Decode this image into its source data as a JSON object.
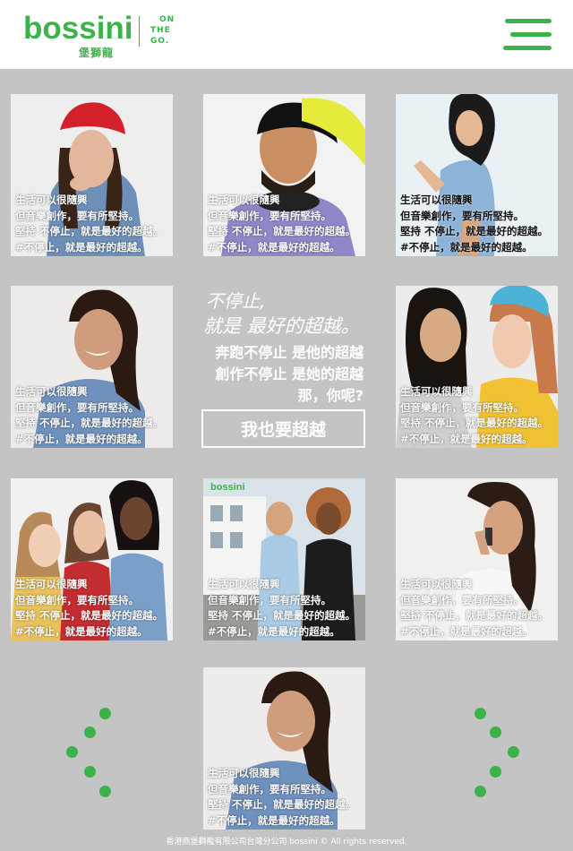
{
  "header": {
    "logo_text": "bossini",
    "logo_sub": "堡獅龍",
    "tagline": [
      "ON",
      "THE",
      "GO."
    ],
    "menu_icon": "hamburger-menu-icon"
  },
  "captions": {
    "line1": "生活可以很隨興",
    "line2": "但音樂創作，要有所堅持。",
    "line3": "堅持 不停止，就是最好的超越。",
    "line4": "#不停止，就是最好的超越。"
  },
  "center": {
    "heading1": "不停止,",
    "heading2": "就是 最好的超越。",
    "line1": "奔跑不停止 是他的超越",
    "line2": "創作不停止 是她的超越",
    "line3": "那，你呢?",
    "button": "我也要超越"
  },
  "tile_logo": "bossini",
  "colors": {
    "accent": "#3cb24a",
    "background": "#c4c4c4"
  },
  "footer": {
    "copyright": "香港商堡獅龍有限公司台灣分公司 bossini © All rights reserved."
  }
}
